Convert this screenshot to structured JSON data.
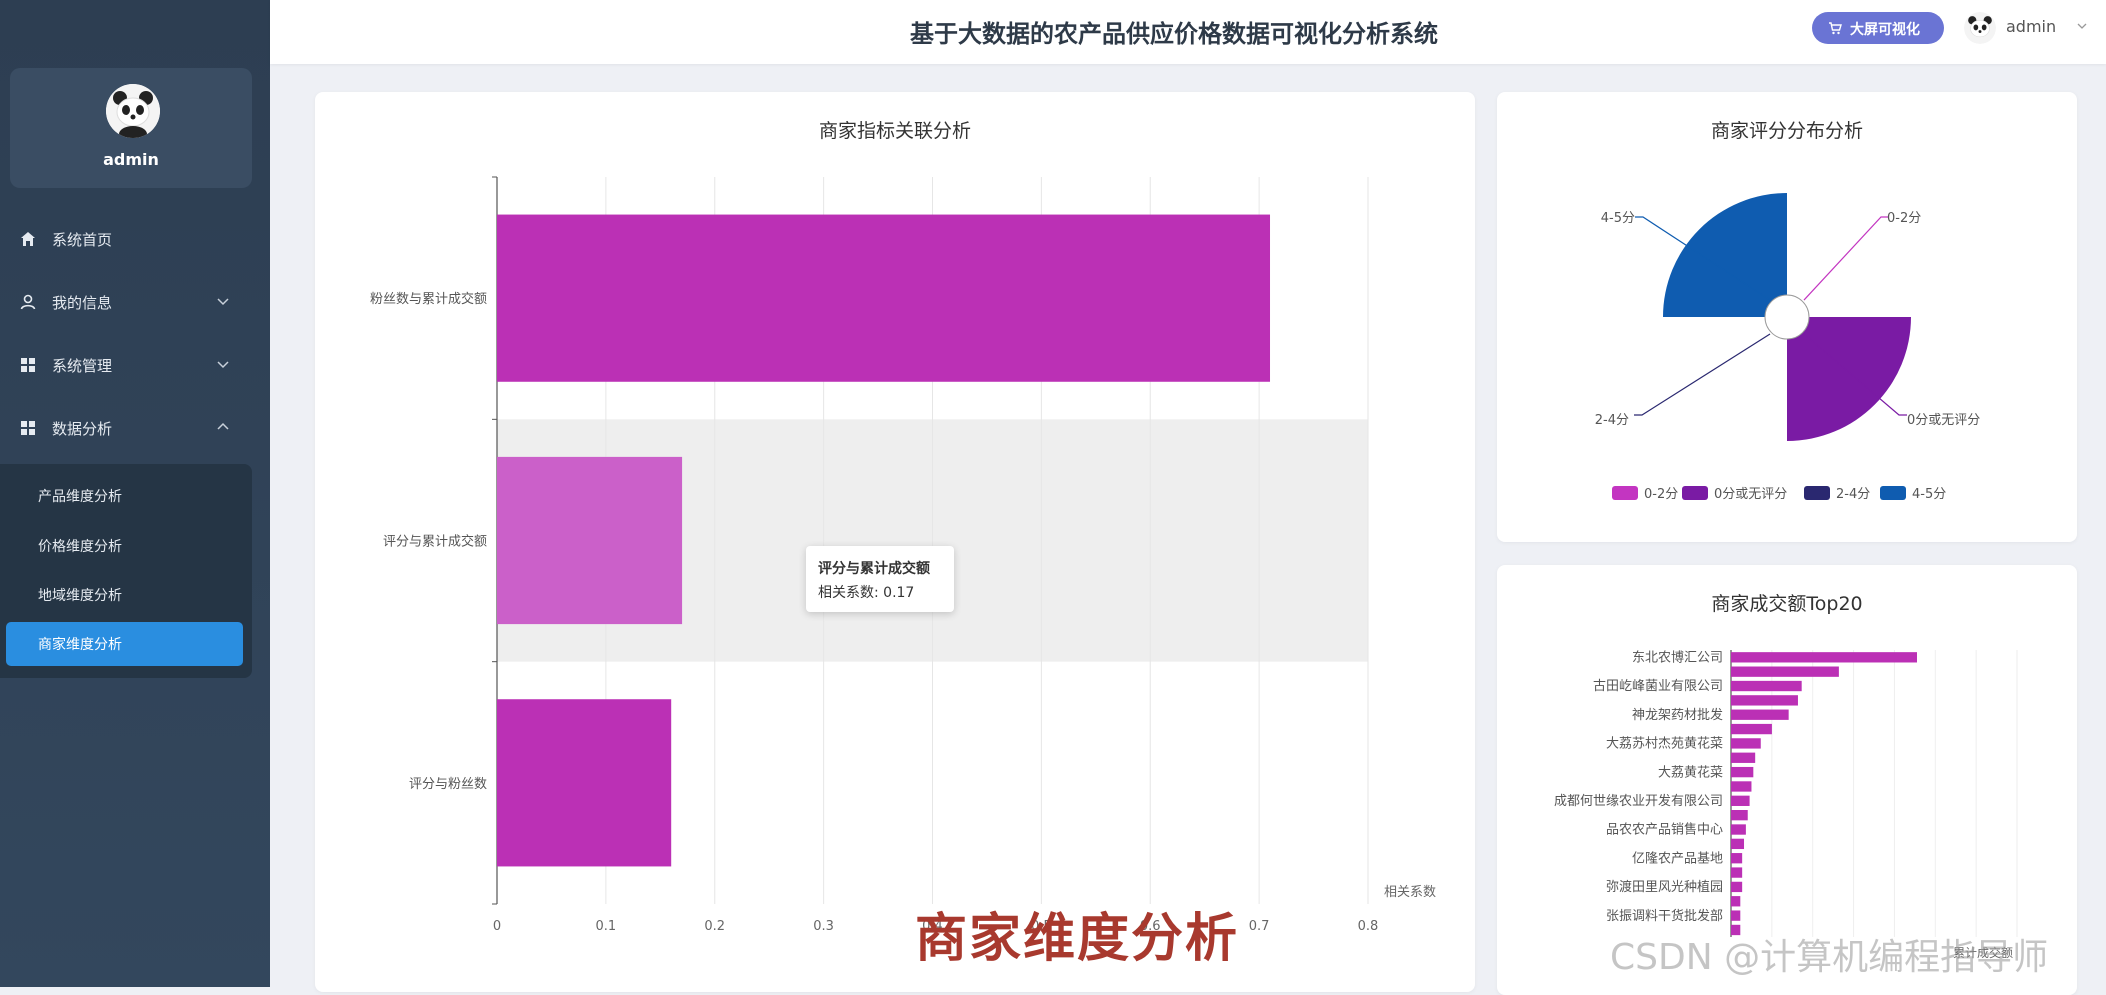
{
  "app": {
    "title": "基于大数据的农产品供应价格数据可视化分析系统"
  },
  "header": {
    "bigscreen_label": "大屏可视化",
    "user_name": "admin"
  },
  "sidebar": {
    "profile_name": "admin",
    "items": [
      {
        "label": "系统首页",
        "icon": "home-icon"
      },
      {
        "label": "我的信息",
        "icon": "user-icon",
        "expanded": false
      },
      {
        "label": "系统管理",
        "icon": "grid-icon",
        "expanded": false
      },
      {
        "label": "数据分析",
        "icon": "grid-icon",
        "expanded": true
      }
    ],
    "sub_items": [
      {
        "label": "产品维度分析"
      },
      {
        "label": "价格维度分析"
      },
      {
        "label": "地域维度分析"
      },
      {
        "label": "商家维度分析",
        "active": true
      }
    ]
  },
  "card1": {
    "title": "商家指标关联分析",
    "tooltip_title": "评分与累计成交额",
    "tooltip_value": "相关系数: 0.17"
  },
  "card2": {
    "title": "商家评分分布分析"
  },
  "card3": {
    "title": "商家成交额Top20"
  },
  "overlay_caption": "商家维度分析",
  "watermark": "CSDN @计算机编程指导师",
  "chart_data": [
    {
      "type": "bar",
      "orientation": "horizontal",
      "title": "商家指标关联分析",
      "categories": [
        "粉丝数与累计成交额",
        "评分与累计成交额",
        "评分与粉丝数"
      ],
      "values": [
        0.71,
        0.17,
        0.16
      ],
      "xlabel": "相关系数",
      "xlim": [
        0,
        0.8
      ],
      "xticks": [
        "0",
        "0.1",
        "0.2",
        "0.3",
        "0.4",
        "0.5",
        "0.6",
        "0.7",
        "0.8"
      ],
      "highlighted_category": "评分与累计成交额",
      "bar_color": "#bb30b5",
      "highlight_color": "#cb60c9",
      "grid": true
    },
    {
      "type": "pie",
      "variant": "rose",
      "title": "商家评分分布分析",
      "categories": [
        "0-2分",
        "0分或无评分",
        "2-4分",
        "4-5分"
      ],
      "values": [
        0,
        1,
        0,
        1
      ],
      "colors": [
        "#c335c1",
        "#7a1ba4",
        "#2a2870",
        "#0f5cb0"
      ],
      "legend": "bottom"
    },
    {
      "type": "bar",
      "orientation": "horizontal",
      "title": "商家成交额Top20",
      "categories": [
        "东北农博汇公司",
        "",
        "古田屹峰菌业有限公司",
        "",
        "神龙架药材批发",
        "",
        "大荔苏村杰苑黄花菜",
        "",
        "大荔黄花菜",
        "",
        "成都何世缘农业开发有限公司",
        "",
        "品农农产品销售中心",
        "",
        "亿隆农产品基地",
        "",
        "弥渡田里风光种植园",
        "",
        "张振调料干货批发部",
        ""
      ],
      "values": [
        1.0,
        0.58,
        0.38,
        0.36,
        0.31,
        0.22,
        0.16,
        0.13,
        0.12,
        0.11,
        0.1,
        0.09,
        0.08,
        0.07,
        0.06,
        0.06,
        0.06,
        0.05,
        0.05,
        0.05
      ],
      "xlabel": "累计成交额",
      "bar_color": "#bb30b5",
      "grid": true
    }
  ]
}
